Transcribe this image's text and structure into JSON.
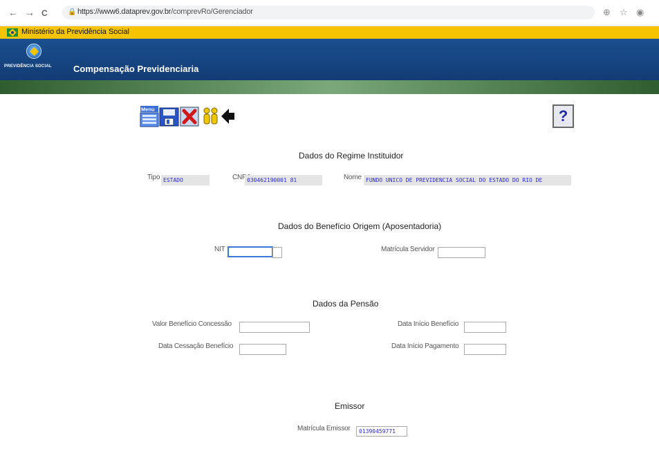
{
  "browser": {
    "back": "←",
    "forward": "→",
    "reload": "C",
    "url_host": "https://www6.dataprev.gov.br",
    "url_path": "/comprevRo/Gerenciador",
    "zoom_icon": "zoom-icon",
    "star_icon": "star-icon",
    "profile_icon": "profile-icon"
  },
  "ministry": {
    "label": "Ministério da Previdência Social"
  },
  "header": {
    "logo_text": "PREVIDÊNCIA SOCIAL",
    "title": "Compensação Previdenciaria"
  },
  "toolbar": {
    "menu_label": "Menu",
    "help_label": "?"
  },
  "regime": {
    "title": "Dados do Regime Instituidor",
    "tipo_label": "Tipo",
    "tipo_value": "ESTADO",
    "cnpj_label": "CNPJ",
    "cnpj_value": "030462190001  81",
    "nome_label": "Nome",
    "nome_value": "FUNDO UNICO DE PREVIDENCIA SOCIAL DO ESTADO DO RIO DE"
  },
  "beneficio": {
    "title": "Dados do Benefício Origem (Aposentadoria)",
    "nit_label": "NIT",
    "nit_value": "",
    "matricula_label": "Matrícula Servidor",
    "matricula_value": ""
  },
  "pensao": {
    "title": "Dados da Pensão",
    "valor_label": "Valor Benefício Concessão",
    "valor_value": "",
    "data_inicio_label": "Data Início Benefício",
    "data_inicio_value": "",
    "data_cessacao_label": "Data Cessação Benefício",
    "data_cessacao_value": "",
    "data_pagamento_label": "Data Início Pagamento",
    "data_pagamento_value": ""
  },
  "emissor": {
    "title": "Emissor",
    "matricula_label": "Matrícula Emissor",
    "matricula_value": "01390459771"
  },
  "colors": {
    "ministry_bar": "#f5c400",
    "header_blue": "#1b4f8f",
    "green_stripe": "#5a8a5a",
    "field_text": "#2a2ad0"
  }
}
